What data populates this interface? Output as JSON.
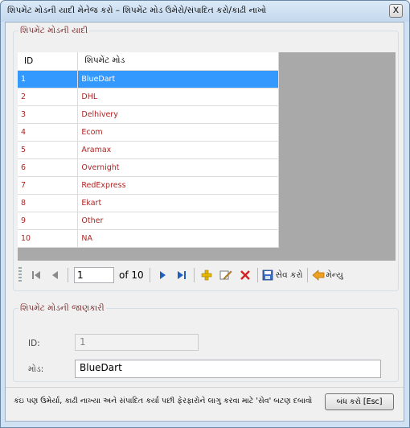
{
  "window": {
    "title": "શિપમેંટ મોડની યાદી મેનેજ કરો – શિપમેંટ મોડ ઉમેરો/સંપાદિત કરો/કાઢી નાખો",
    "close_glyph": "x"
  },
  "list_group": {
    "legend": "શિપમેંટ મોડની યાદી",
    "columns": [
      "ID",
      "શિપમેંટ મોડ"
    ],
    "rows": [
      {
        "id": "1",
        "mode": "BlueDart"
      },
      {
        "id": "2",
        "mode": "DHL"
      },
      {
        "id": "3",
        "mode": "Delhivery"
      },
      {
        "id": "4",
        "mode": "Ecom"
      },
      {
        "id": "5",
        "mode": "Aramax"
      },
      {
        "id": "6",
        "mode": "Overnight"
      },
      {
        "id": "7",
        "mode": "RedExpress"
      },
      {
        "id": "8",
        "mode": "Ekart"
      },
      {
        "id": "9",
        "mode": "Other"
      },
      {
        "id": "10",
        "mode": "NA"
      }
    ],
    "selected_index": 0
  },
  "navigator": {
    "position": "1",
    "count_label": "of 10",
    "save_label": "સેવ કરો",
    "menu_label": "મેન્યુ"
  },
  "detail_group": {
    "legend": "શિપમેંટ મોડની જાણકારી",
    "id_label": "ID:",
    "id_value": "1",
    "mode_label": "મોડ:",
    "mode_value": "BlueDart"
  },
  "footer": {
    "hint": "કંઇ પણ ઉમેર્યા, કાઢી નાખ્યા અને સંપાદિત કર્યા પછી ફેરફારોને લાગુ કરવા માટે 'સેવ' બટણ દબાવો",
    "close_button": "બંધ કરો [Esc]"
  },
  "colors": {
    "selection": "#3399ff",
    "value_text": "#b22222",
    "legend_text": "#7a2a2a",
    "grid_background": "#a9a9a9"
  }
}
